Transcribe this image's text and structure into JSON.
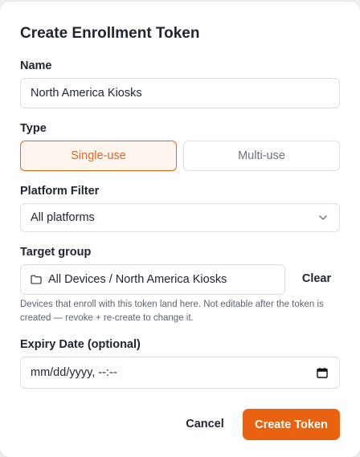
{
  "modal": {
    "title": "Create Enrollment Token"
  },
  "name": {
    "label": "Name",
    "value": "North America Kiosks"
  },
  "type": {
    "label": "Type",
    "options": [
      "Single-use",
      "Multi-use"
    ],
    "selected": "Single-use"
  },
  "platform": {
    "label": "Platform Filter",
    "value": "All platforms",
    "icon": "chevron-down-icon"
  },
  "target": {
    "label": "Target group",
    "value": "All Devices / North America Kiosks",
    "icon": "folder-icon",
    "clear_label": "Clear",
    "help": "Devices that enroll with this token land here. Not editable after the token is created — revoke + re-create to change it."
  },
  "expiry": {
    "label": "Expiry Date (optional)",
    "placeholder": "mm/dd/yyyy, --:--",
    "icon": "calendar-icon"
  },
  "actions": {
    "cancel_label": "Cancel",
    "submit_label": "Create Token"
  },
  "colors": {
    "accent": "#e8620f",
    "accent_bg": "#fef5ee",
    "text": "#1f2430",
    "border": "#dcdfe4"
  }
}
